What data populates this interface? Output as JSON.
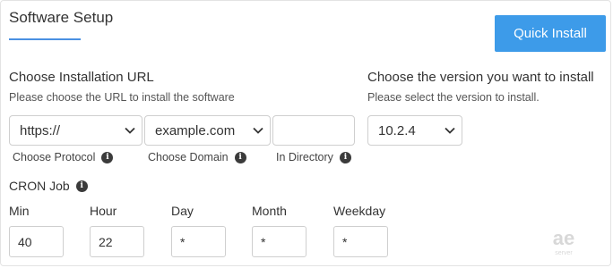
{
  "header": {
    "title": "Software Setup",
    "quick_install_label": "Quick Install"
  },
  "url_section": {
    "heading": "Choose Installation URL",
    "hint": "Please choose the URL to install the software",
    "protocol": {
      "value": "https://",
      "label": "Choose Protocol"
    },
    "domain": {
      "value": "example.com",
      "label": "Choose Domain"
    },
    "directory": {
      "value": "",
      "label": "In Directory"
    }
  },
  "version_section": {
    "heading": "Choose the version you want to install",
    "hint": "Please select the version to install.",
    "selected_version": "10.2.4"
  },
  "cron": {
    "label": "CRON Job",
    "fields": [
      {
        "label": "Min",
        "value": "40"
      },
      {
        "label": "Hour",
        "value": "22"
      },
      {
        "label": "Day",
        "value": "*"
      },
      {
        "label": "Month",
        "value": "*"
      },
      {
        "label": "Weekday",
        "value": "*"
      }
    ]
  },
  "colors": {
    "accent": "#3d9be9",
    "underline": "#4a90e2",
    "border": "#cfcfcf"
  },
  "icons": {
    "info": "info-icon",
    "dropdown": "chevron-down-icon"
  }
}
